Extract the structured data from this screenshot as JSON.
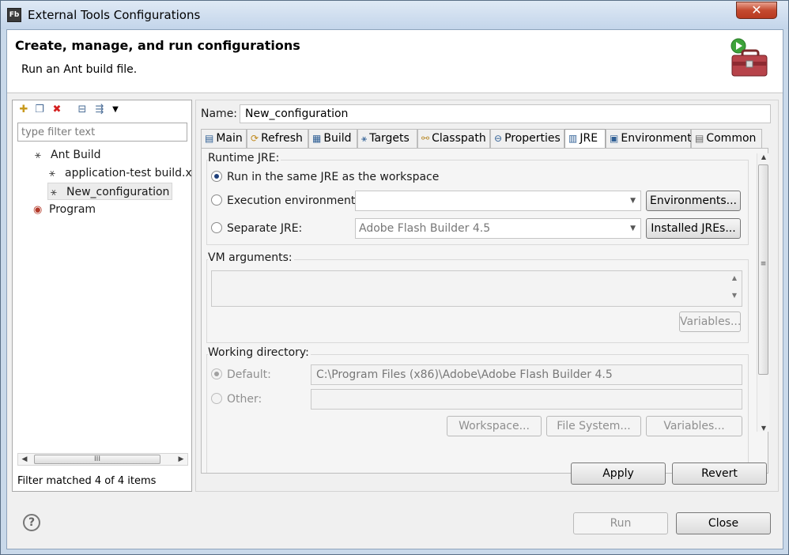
{
  "window": {
    "app_icon_text": "Fb",
    "title": "External Tools Configurations",
    "close_glyph": "✕"
  },
  "header": {
    "title": "Create, manage, and run configurations",
    "message": "Run an Ant build file.",
    "icon": "toolbox-run-icon"
  },
  "left_panel": {
    "toolbar_icons": [
      "new-config-icon",
      "duplicate-icon",
      "delete-icon",
      "collapse-all-icon",
      "filter-icon",
      "view-menu-icon"
    ],
    "filter_placeholder": "type filter text",
    "tree": {
      "ant_build": "Ant Build",
      "application_test": "application-test build.x",
      "new_configuration": "New_configuration",
      "program": "Program"
    },
    "scrollbar_grip": "III",
    "status": "Filter matched 4 of 4 items"
  },
  "right_panel": {
    "name_label": "Name:",
    "name_value": "New_configuration",
    "tabs": [
      {
        "label": "Main",
        "icon": "main-tab-icon"
      },
      {
        "label": "Refresh",
        "icon": "refresh-tab-icon"
      },
      {
        "label": "Build",
        "icon": "build-tab-icon"
      },
      {
        "label": "Targets",
        "icon": "targets-tab-icon"
      },
      {
        "label": "Classpath",
        "icon": "classpath-tab-icon"
      },
      {
        "label": "Properties",
        "icon": "properties-tab-icon"
      },
      {
        "label": "JRE",
        "icon": "jre-tab-icon"
      },
      {
        "label": "Environment",
        "icon": "environment-tab-icon"
      },
      {
        "label": "Common",
        "icon": "common-tab-icon"
      }
    ],
    "active_tab": "JRE",
    "runtime_jre": {
      "label": "Runtime JRE:",
      "option_workspace": "Run in the same JRE as the workspace",
      "option_exec_env": "Execution environment:",
      "exec_env_value": "",
      "environments_button": "Environments...",
      "option_separate": "Separate JRE:",
      "separate_value": "Adobe Flash Builder 4.5",
      "installed_jres_button": "Installed JREs..."
    },
    "vm_arguments": {
      "label": "VM arguments:",
      "value": "",
      "variables_button": "Variables..."
    },
    "working_directory": {
      "label": "Working directory:",
      "option_default": "Default:",
      "default_value": "C:\\Program Files (x86)\\Adobe\\Adobe Flash Builder 4.5",
      "option_other": "Other:",
      "other_value": "",
      "workspace_button": "Workspace...",
      "file_system_button": "File System...",
      "variables_button": "Variables..."
    },
    "apply_button": "Apply",
    "revert_button": "Revert"
  },
  "footer": {
    "help_glyph": "?",
    "run_button": "Run",
    "close_button": "Close"
  }
}
